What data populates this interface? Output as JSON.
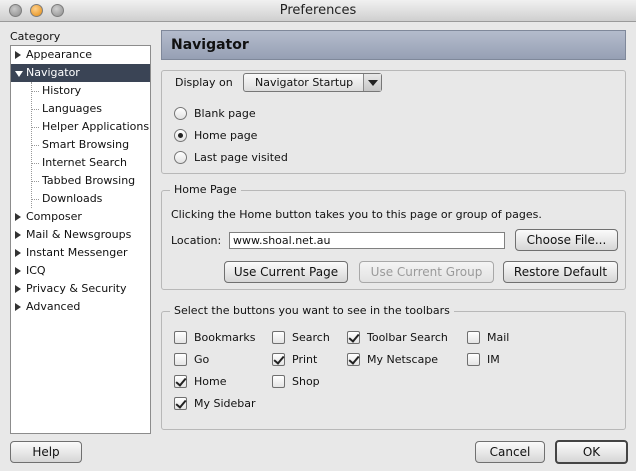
{
  "window": {
    "title": "Preferences"
  },
  "sidebar": {
    "label": "Category",
    "items": [
      {
        "label": "Appearance",
        "level": 0,
        "expanded": false
      },
      {
        "label": "Navigator",
        "level": 0,
        "expanded": true,
        "selected": true
      },
      {
        "label": "History",
        "level": 1
      },
      {
        "label": "Languages",
        "level": 1
      },
      {
        "label": "Helper Applications",
        "level": 1
      },
      {
        "label": "Smart Browsing",
        "level": 1
      },
      {
        "label": "Internet Search",
        "level": 1
      },
      {
        "label": "Tabbed Browsing",
        "level": 1
      },
      {
        "label": "Downloads",
        "level": 1
      },
      {
        "label": "Composer",
        "level": 0,
        "expanded": false
      },
      {
        "label": "Mail & Newsgroups",
        "level": 0,
        "expanded": false
      },
      {
        "label": "Instant Messenger",
        "level": 0,
        "expanded": false
      },
      {
        "label": "ICQ",
        "level": 0,
        "expanded": false
      },
      {
        "label": "Privacy & Security",
        "level": 0,
        "expanded": false
      },
      {
        "label": "Advanced",
        "level": 0,
        "expanded": false
      }
    ]
  },
  "panel": {
    "title": "Navigator"
  },
  "display": {
    "label": "Display on",
    "selected": "Navigator Startup",
    "radios": [
      {
        "label": "Blank page",
        "checked": false
      },
      {
        "label": "Home page",
        "checked": true
      },
      {
        "label": "Last page visited",
        "checked": false
      }
    ]
  },
  "homepage": {
    "legend": "Home Page",
    "description": "Clicking the Home button takes you to this page or group of pages.",
    "location_label": "Location:",
    "location_value": "www.shoal.net.au",
    "choose_file": "Choose File...",
    "use_current_page": "Use Current Page",
    "use_current_group": "Use Current Group",
    "restore_default": "Restore Default"
  },
  "toolbars": {
    "legend": "Select the buttons you want to see in the toolbars",
    "checkboxes": [
      {
        "label": "Bookmarks",
        "checked": false
      },
      {
        "label": "Go",
        "checked": false
      },
      {
        "label": "Home",
        "checked": true
      },
      {
        "label": "My Sidebar",
        "checked": true
      },
      {
        "label": "Search",
        "checked": false
      },
      {
        "label": "Print",
        "checked": true
      },
      {
        "label": "Shop",
        "checked": false
      },
      {
        "label": "Toolbar Search",
        "checked": true
      },
      {
        "label": "My Netscape",
        "checked": true
      },
      {
        "label": "Mail",
        "checked": false
      },
      {
        "label": "IM",
        "checked": false
      }
    ]
  },
  "footer": {
    "help": "Help",
    "cancel": "Cancel",
    "ok": "OK"
  }
}
